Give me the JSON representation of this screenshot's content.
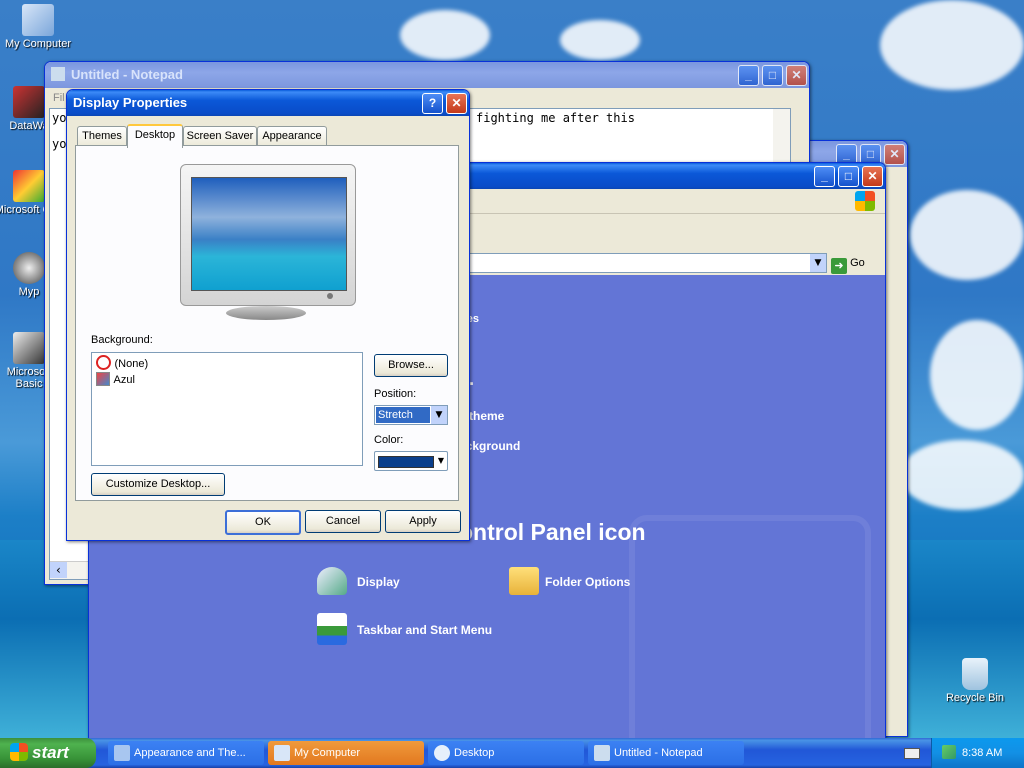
{
  "desktop": {
    "icons": [
      {
        "label": "My Computer"
      },
      {
        "label": "DataWa"
      },
      {
        "label": "Microsoft C++"
      },
      {
        "label": "Myp"
      },
      {
        "label": "Microsoft Basic"
      },
      {
        "label": "Recycle Bin"
      }
    ]
  },
  "notepad": {
    "title": "Untitled - Notepad",
    "menu_fragment": "Fil",
    "text_line1": "yo",
    "text_visible": "fighting me after this",
    "text_line2": "yo"
  },
  "control_panel": {
    "go_label": "Go",
    "themes_link": "mes",
    "ellipsis": "...",
    "task1": "s theme",
    "task2": "ackground",
    "pick_header": "ontrol Panel icon",
    "items": [
      {
        "label": "Display"
      },
      {
        "label": "Folder Options"
      },
      {
        "label": "Taskbar and Start Menu"
      }
    ]
  },
  "dialog": {
    "title": "Display Properties",
    "help_glyph": "?",
    "tabs": [
      "Themes",
      "Desktop",
      "Screen Saver",
      "Appearance"
    ],
    "active_tab": "Desktop",
    "background_label": "Background:",
    "backgrounds": [
      {
        "label": "(None)",
        "icon": "no-icon"
      },
      {
        "label": "Azul",
        "icon": "image-file-icon"
      }
    ],
    "browse_label": "Browse...",
    "position_label": "Position:",
    "position_value": "Stretch",
    "color_label": "Color:",
    "color_value": "#0a3f8c",
    "customize_label": "Customize Desktop...",
    "ok_label": "OK",
    "cancel_label": "Cancel",
    "apply_label": "Apply"
  },
  "taskbar": {
    "start_label": "start",
    "tasks": [
      {
        "label": "Appearance and The..."
      },
      {
        "label": "My Computer"
      },
      {
        "label": "Desktop"
      },
      {
        "label": "Untitled - Notepad"
      }
    ],
    "clock": "8:38 AM"
  }
}
